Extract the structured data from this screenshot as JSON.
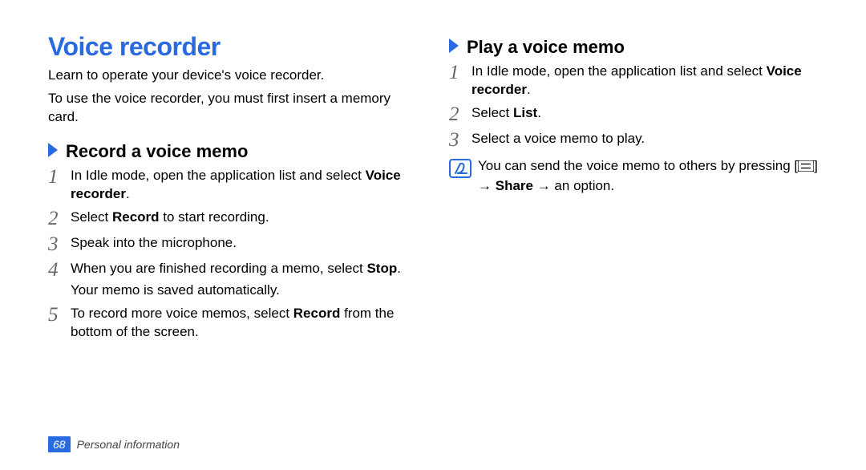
{
  "title": "Voice recorder",
  "intro1": "Learn to operate your device's voice recorder.",
  "intro2": "To use the voice recorder, you must first insert a memory card.",
  "left": {
    "heading": "Record a voice memo",
    "steps": {
      "s1a": "In Idle mode, open the application list and select ",
      "s1b": "Voice recorder",
      "s1c": ".",
      "s2a": "Select ",
      "s2b": "Record",
      "s2c": " to start recording.",
      "s3": "Speak into the microphone.",
      "s4a": "When you are finished recording a memo, select ",
      "s4b": "Stop",
      "s4c": ".",
      "s4sub": "Your memo is saved automatically.",
      "s5a": "To record more voice memos, select ",
      "s5b": "Record",
      "s5c": " from the bottom of the screen."
    }
  },
  "right": {
    "heading": "Play a voice memo",
    "steps": {
      "s1a": "In Idle mode, open the application list and select ",
      "s1b": "Voice recorder",
      "s1c": ".",
      "s2a": "Select ",
      "s2b": "List",
      "s2c": ".",
      "s3": "Select a voice memo to play."
    },
    "noteA": "You can send the voice memo to others by pressing [",
    "noteB": "] → ",
    "noteBold": "Share",
    "noteC": " → an option."
  },
  "footer": {
    "page": "68",
    "section": "Personal information"
  },
  "nums": {
    "n1": "1",
    "n2": "2",
    "n3": "3",
    "n4": "4",
    "n5": "5"
  }
}
